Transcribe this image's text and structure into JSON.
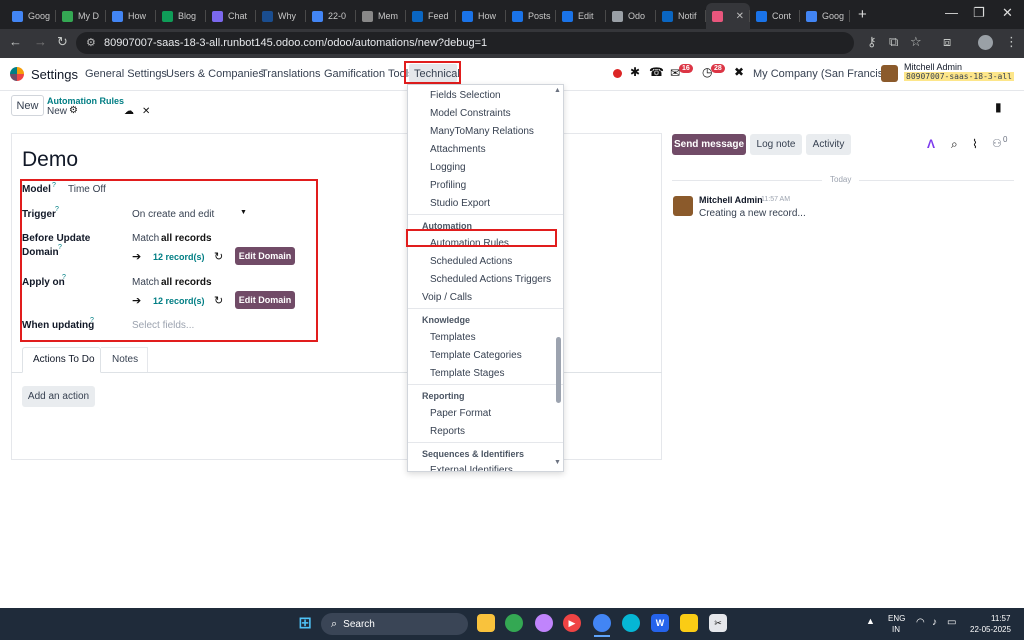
{
  "browser": {
    "tabs": [
      {
        "label": "Goog",
        "color": "#4285f4"
      },
      {
        "label": "My D",
        "color": "#34a853"
      },
      {
        "label": "How",
        "color": "#4285f4"
      },
      {
        "label": "Blog",
        "color": "#0f9d58"
      },
      {
        "label": "Chat",
        "color": "#7b68ee"
      },
      {
        "label": "Why",
        "color": "#1a4d8f"
      },
      {
        "label": "22-0",
        "color": "#4285f4"
      },
      {
        "label": "Mem",
        "color": "#888888"
      },
      {
        "label": "Feed",
        "color": "#0a66c2"
      },
      {
        "label": "How",
        "color": "#1a73e8"
      },
      {
        "label": "Posts",
        "color": "#1a73e8"
      },
      {
        "label": "Edit",
        "color": "#1a73e8"
      },
      {
        "label": "Odo",
        "color": "#9aa0a6"
      },
      {
        "label": "Notif",
        "color": "#0a66c2"
      },
      {
        "label": "",
        "color": "#e8567c"
      },
      {
        "label": "Cont",
        "color": "#1a73e8"
      },
      {
        "label": "Goog",
        "color": "#4285f4"
      }
    ],
    "url": "80907007-saas-18-3-all.runbot145.odoo.com/odoo/automations/new?debug=1"
  },
  "navbar": {
    "app_name": "Settings",
    "menu": [
      "General Settings",
      "Users & Companies",
      "Translations",
      "Gamification Tools",
      "Technical"
    ],
    "msg_badge": "16",
    "activity_badge": "28",
    "company": "My Company (San Francisco)",
    "user_name": "Mitchell Admin",
    "db_name": "80907007-saas-18-3-all"
  },
  "control": {
    "new_button": "New",
    "breadcrumb_parent": "Automation Rules",
    "breadcrumb_current": "New"
  },
  "form": {
    "title": "Demo",
    "model_label": "Model",
    "model_value": "Time Off",
    "trigger_label": "Trigger",
    "trigger_value": "On create and edit",
    "before_label_1": "Before Update",
    "before_label_2": "Domain",
    "match_prefix": "Match",
    "match_bold": "all records",
    "records": "12 record(s)",
    "edit_domain": "Edit Domain",
    "apply_label": "Apply on",
    "when_label": "When updating",
    "when_placeholder": "Select fields...",
    "tabs": [
      "Actions To Do",
      "Notes"
    ],
    "add_action": "Add an action"
  },
  "chatter": {
    "send_message": "Send message",
    "log_note": "Log note",
    "activity": "Activity",
    "followers": "0",
    "date_sep": "Today",
    "author": "Mitchell Admin",
    "time": "11:57 AM",
    "body": "Creating a new record..."
  },
  "dropdown": {
    "items": [
      {
        "t": "item",
        "label": "Fields Selection"
      },
      {
        "t": "item",
        "label": "Model Constraints"
      },
      {
        "t": "item",
        "label": "ManyToMany Relations"
      },
      {
        "t": "item",
        "label": "Attachments"
      },
      {
        "t": "item",
        "label": "Logging"
      },
      {
        "t": "item",
        "label": "Profiling"
      },
      {
        "t": "item",
        "label": "Studio Export"
      },
      {
        "t": "head",
        "label": "Automation"
      },
      {
        "t": "item",
        "label": "Automation Rules"
      },
      {
        "t": "item",
        "label": "Scheduled Actions"
      },
      {
        "t": "item",
        "label": "Scheduled Actions Triggers"
      },
      {
        "t": "top",
        "label": "Voip / Calls"
      },
      {
        "t": "head",
        "label": "Knowledge"
      },
      {
        "t": "item",
        "label": "Templates"
      },
      {
        "t": "item",
        "label": "Template Categories"
      },
      {
        "t": "item",
        "label": "Template Stages"
      },
      {
        "t": "head",
        "label": "Reporting"
      },
      {
        "t": "item",
        "label": "Paper Format"
      },
      {
        "t": "item",
        "label": "Reports"
      },
      {
        "t": "head",
        "label": "Sequences & Identifiers"
      },
      {
        "t": "item",
        "label": "External Identifiers"
      }
    ]
  },
  "taskbar": {
    "search": "Search",
    "lang_1": "ENG",
    "lang_2": "IN",
    "time": "11:57",
    "date": "22-05-2025"
  },
  "colors": {
    "brand": "#714b67",
    "teal": "#017e84",
    "highlight": "#e11d1d"
  }
}
